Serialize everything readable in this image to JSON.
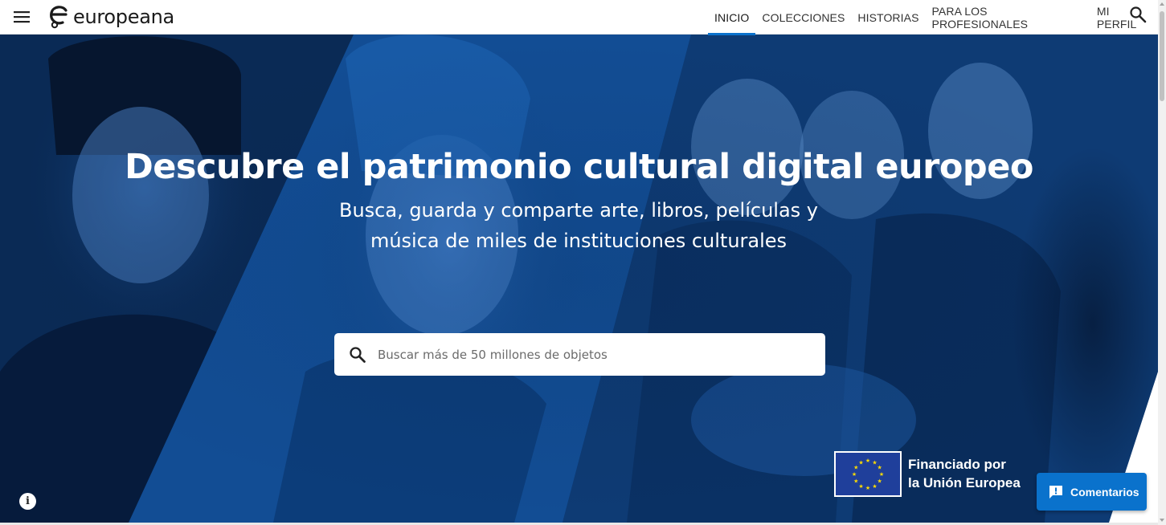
{
  "header": {
    "logo_text": "europeana",
    "nav": [
      {
        "label": "INICIO",
        "active": true
      },
      {
        "label": "COLECCIONES",
        "active": false
      },
      {
        "label": "HISTORIAS",
        "active": false
      },
      {
        "label": "PARA LOS PROFESIONALES",
        "active": false
      },
      {
        "label": "MI PERFIL",
        "active": false
      }
    ],
    "icons": {
      "menu": "hamburger-menu-icon",
      "search": "search-icon"
    }
  },
  "hero": {
    "title": "Descubre el patrimonio cultural digital europeo",
    "subtitle_line1": "Busca, guarda y comparte arte, libros, películas y",
    "subtitle_line2": "música de miles de instituciones culturales",
    "search_placeholder": "Buscar más de 50 millones de objetos"
  },
  "eu_funding": {
    "line1": "Financiado por",
    "line2": "la Unión Europea"
  },
  "feedback": {
    "label": "Comentarios"
  },
  "colors": {
    "accent": "#0a72cc",
    "hero_blue": "#114b91",
    "eu_blue": "#1f3f9b",
    "eu_star": "#ffdd00"
  }
}
